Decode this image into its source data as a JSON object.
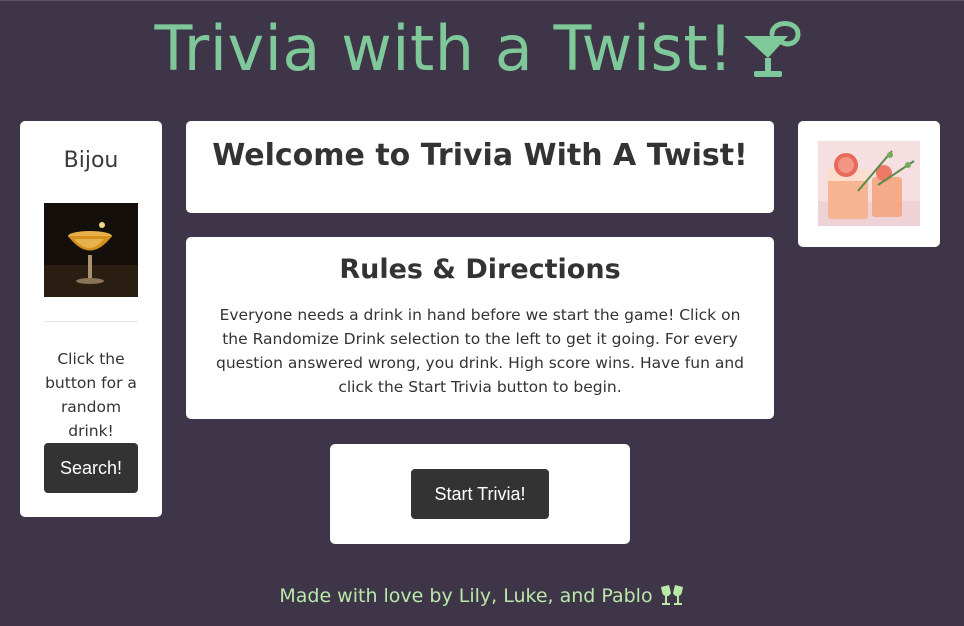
{
  "header": {
    "title": "Trivia with a Twist!",
    "icon": "martini-icon"
  },
  "sidebar": {
    "drink_name": "Bijou",
    "instruction": "Click the button for a random drink!",
    "search_label": "Search!"
  },
  "welcome": {
    "title": "Welcome to Trivia With A Twist!"
  },
  "rules": {
    "title": "Rules & Directions",
    "body": "Everyone needs a drink in hand before we start the game! Click on the Randomize Drink selection to the left to get it going. For every question answered wrong, you drink. High score wins. Have fun and click the Start Trivia button to begin."
  },
  "start": {
    "label": "Start Trivia!"
  },
  "footer": {
    "text": "Made with love by Lily, Luke, and Pablo",
    "icon": "clinking-glasses-icon"
  },
  "colors": {
    "background": "#3e3648",
    "accent": "#7ec899",
    "footer_text": "#b9e8a8",
    "button": "#333333"
  }
}
